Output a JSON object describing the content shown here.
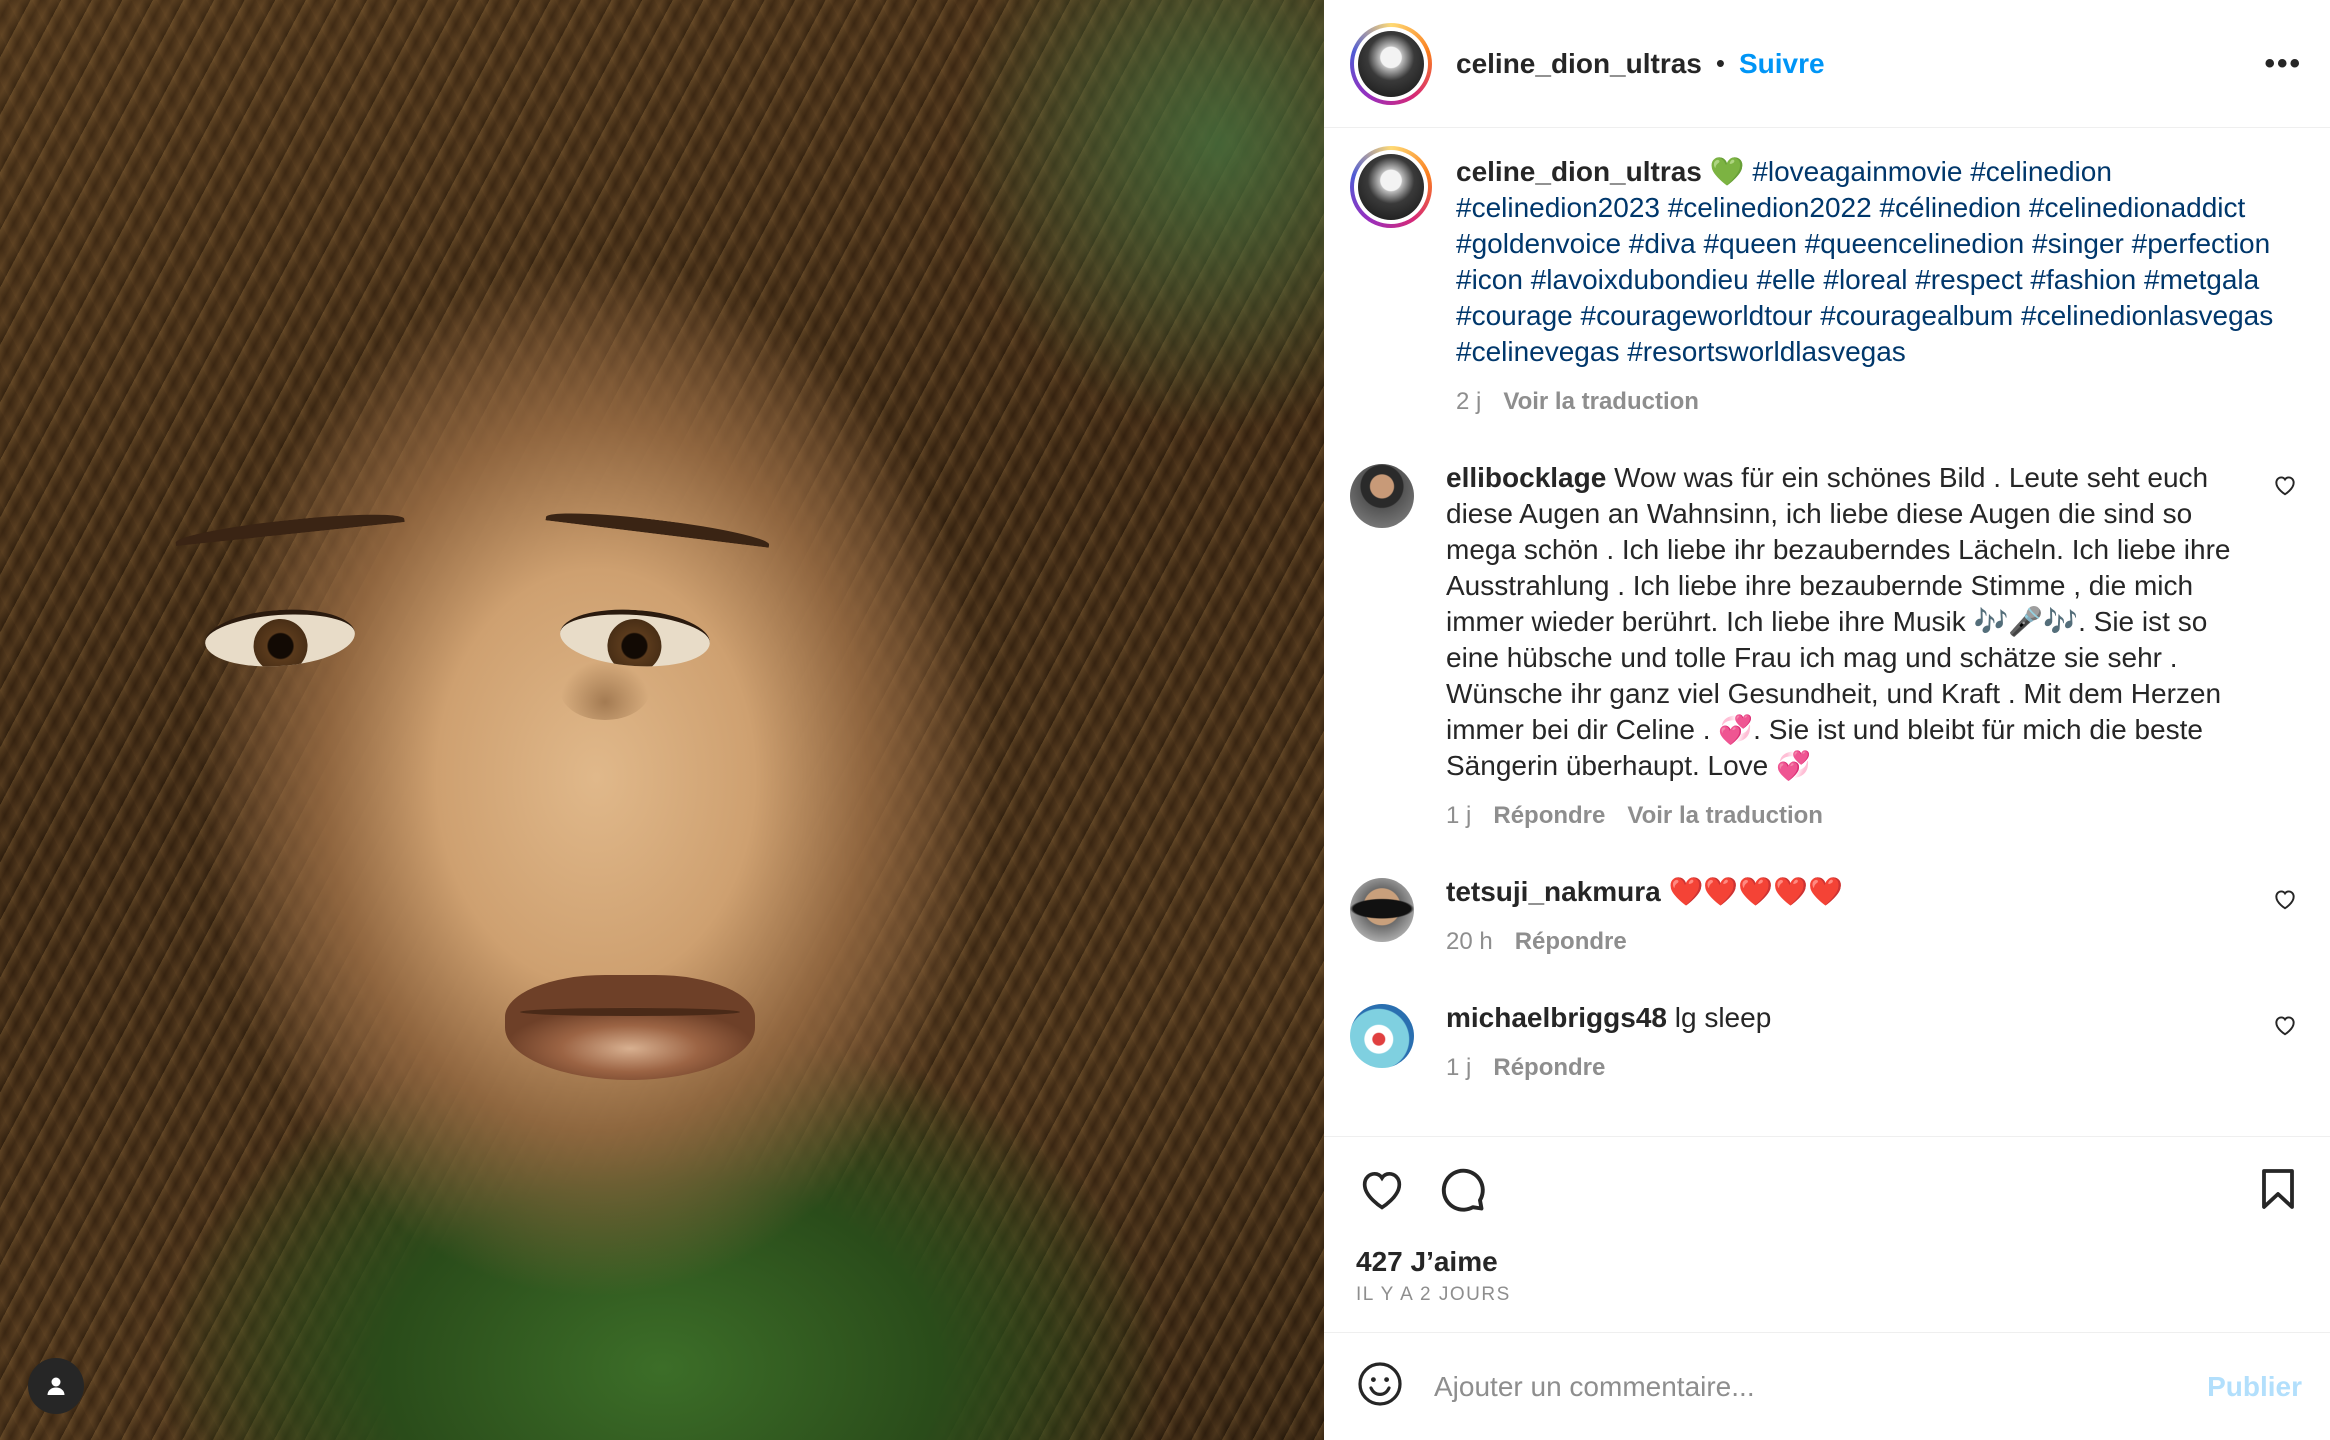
{
  "post": {
    "username": "celine_dion_ultras",
    "separator": "•",
    "follow_label": "Suivre",
    "more_label": "•••"
  },
  "caption": {
    "username": "celine_dion_ultras",
    "emoji": "💚",
    "hashtags": "#loveagainmovie #celinedion #celinedion2023 #celinedion2022 #célinedion #celinedionaddict #goldenvoice #diva #queen #queencelinedion #singer #perfection #icon #lavoixdubondieu #elle #loreal #respect #fashion #metgala #courage #courageworldtour #couragealbum #celinedionlasvegas #celinevegas #resortsworldlasvegas",
    "age": "2 j",
    "translate_label": "Voir la traduction"
  },
  "comments": [
    {
      "username": "ellibocklage",
      "text": "Wow was für ein schönes Bild . Leute seht euch diese Augen an Wahnsinn, ich liebe diese Augen die sind so mega schön . Ich liebe ihr bezauberndes Lächeln. Ich liebe ihre Ausstrahlung . Ich liebe ihre bezaubernde Stimme , die mich immer wieder berührt. Ich liebe ihre Musik 🎶🎤🎶. Sie ist so eine hübsche und tolle Frau ich mag und schätze sie sehr . Wünsche ihr ganz viel Gesundheit, und Kraft . Mit dem Herzen immer bei dir Celine . 💞. Sie ist und bleibt für mich die beste Sängerin überhaupt. Love 💞",
      "age": "1 j",
      "reply_label": "Répondre",
      "translate_label": "Voir la traduction"
    },
    {
      "username": "tetsuji_nakmura",
      "text": "❤️❤️❤️❤️❤️",
      "age": "20 h",
      "reply_label": "Répondre"
    },
    {
      "username": "michaelbriggs48",
      "text": "lg sleep",
      "age": "1 j",
      "reply_label": "Répondre"
    }
  ],
  "engagement": {
    "likes": "427 J’aime",
    "posted": "IL Y A 2 JOURS"
  },
  "compose": {
    "placeholder": "Ajouter un commentaire...",
    "publish_label": "Publier"
  },
  "colors": {
    "link": "#00376b",
    "follow": "#0095f6",
    "muted": "#8e8e8e",
    "publish_disabled": "#b2dffc"
  }
}
